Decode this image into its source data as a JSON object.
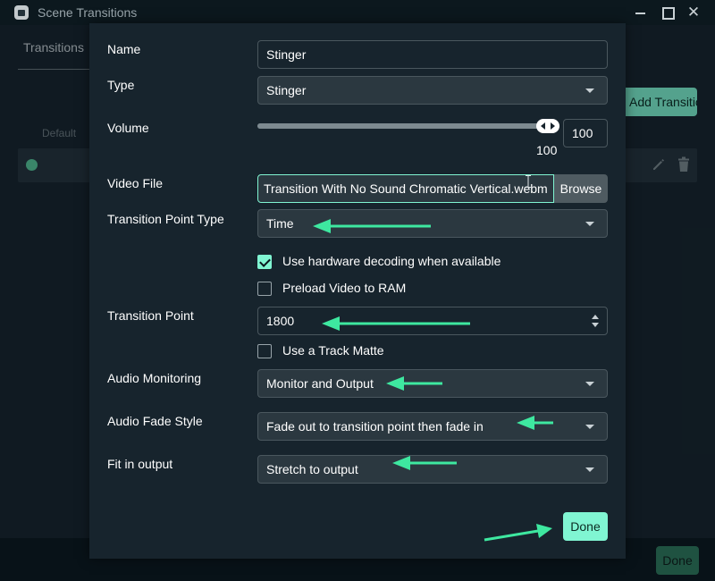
{
  "window": {
    "title": "Scene Transitions",
    "controls": [
      "minimize-icon",
      "maximize-icon",
      "close-icon"
    ],
    "close_glyph": "✕"
  },
  "background": {
    "tab_label": "Transitions",
    "add_transition_label": "Add Transition",
    "column_default_label": "Default",
    "done_label": "Done",
    "row_icons": [
      "default-dot-icon",
      "pencil-icon",
      "trash-icon"
    ]
  },
  "modal": {
    "name_label": "Name",
    "name_value": "Stinger",
    "type_label": "Type",
    "type_value": "Stinger",
    "volume_label": "Volume",
    "volume_value": 100,
    "volume_fraction": 1.0,
    "volume_input_value": "100",
    "volume_value_text": "100",
    "video_file_label": "Video File",
    "video_file_value": "Transition With No Sound Chromatic Vertical.webm",
    "browse_label": "Browse",
    "transition_point_type_label": "Transition Point Type",
    "transition_point_type_value": "Time",
    "hw_decoding_label": "Use hardware decoding when available",
    "hw_decoding_checked": true,
    "preload_label": "Preload Video to RAM",
    "preload_checked": false,
    "transition_point_label": "Transition Point",
    "transition_point_value": "1800",
    "track_matte_label": "Use a Track Matte",
    "track_matte_checked": false,
    "audio_monitoring_label": "Audio Monitoring",
    "audio_monitoring_value": "Monitor and Output",
    "audio_fade_style_label": "Audio Fade Style",
    "audio_fade_style_value": "Fade out to transition point then fade in",
    "fit_in_output_label": "Fit in output",
    "fit_in_output_value": "Stretch to output",
    "done_label": "Done"
  },
  "colors": {
    "accent": "#80f5d2",
    "annotation_arrow": "#3ee8a0",
    "panel": "#17242d",
    "input_bg": "#2b3840",
    "titlebar": "#0c181e"
  }
}
